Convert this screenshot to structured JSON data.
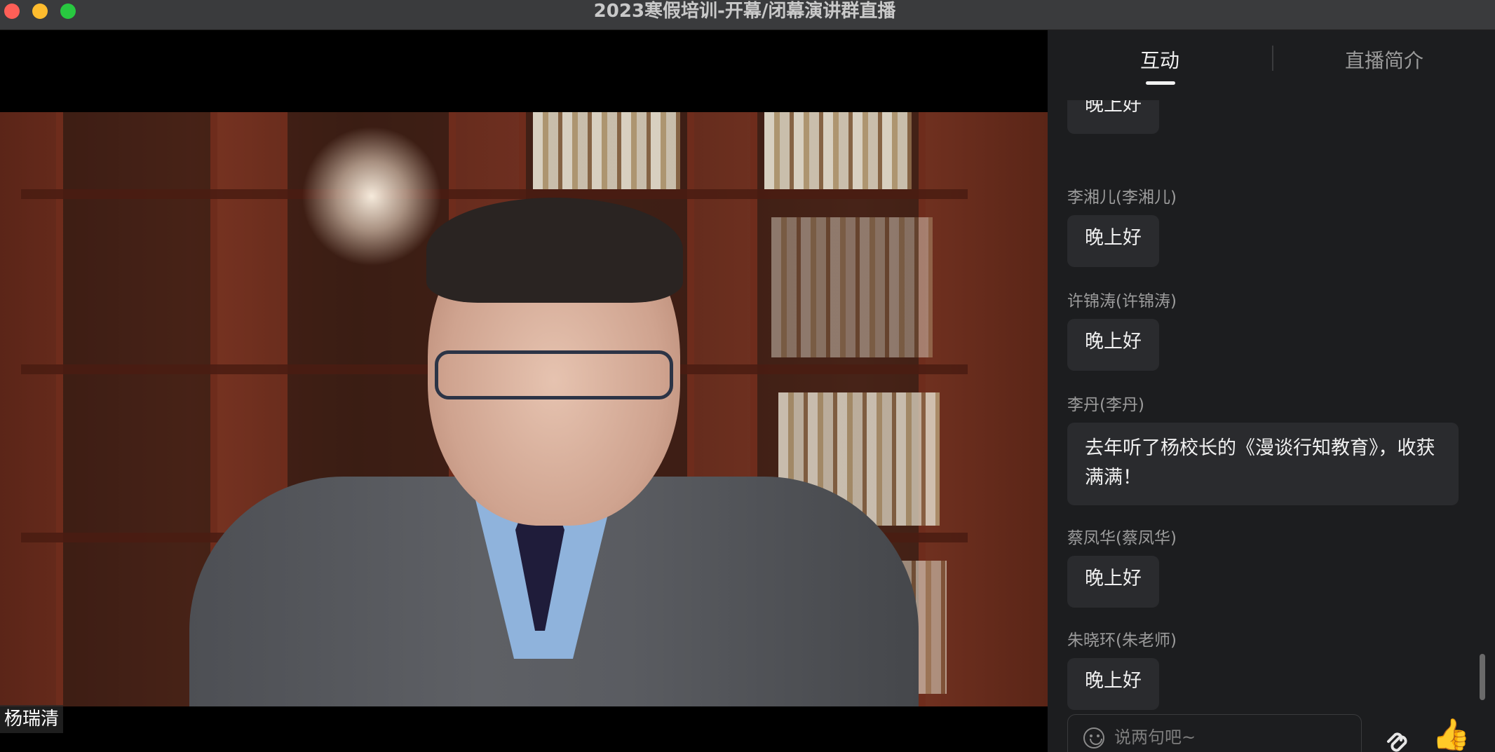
{
  "window": {
    "title": "2023寒假培训-开幕/闭幕演讲群直播"
  },
  "video": {
    "speaker_name": "杨瑞清"
  },
  "panel": {
    "tabs": [
      {
        "label": "互动",
        "active": true
      },
      {
        "label": "直播简介",
        "active": false
      }
    ],
    "messages": [
      {
        "sender": "",
        "text": "晚上好"
      },
      {
        "sender": "李湘儿(李湘儿)",
        "text": "晚上好"
      },
      {
        "sender": "许锦涛(许锦涛)",
        "text": "晚上好"
      },
      {
        "sender": "李丹(李丹)",
        "text": "去年听了杨校长的《漫谈行知教育》，收获满满！"
      },
      {
        "sender": "蔡凤华(蔡凤华)",
        "text": "晚上好"
      },
      {
        "sender": "朱晓环(朱老师)",
        "text": "晚上好"
      }
    ],
    "input": {
      "placeholder": "说两句吧~",
      "value": ""
    },
    "icons": {
      "emoji": "smile-icon",
      "share": "share-icon",
      "like": "thumbs-up-icon"
    }
  },
  "colors": {
    "panel_bg": "#1c1d1f",
    "bubble_bg": "#2a2b2e",
    "titlebar_bg": "#3a3b3d"
  }
}
